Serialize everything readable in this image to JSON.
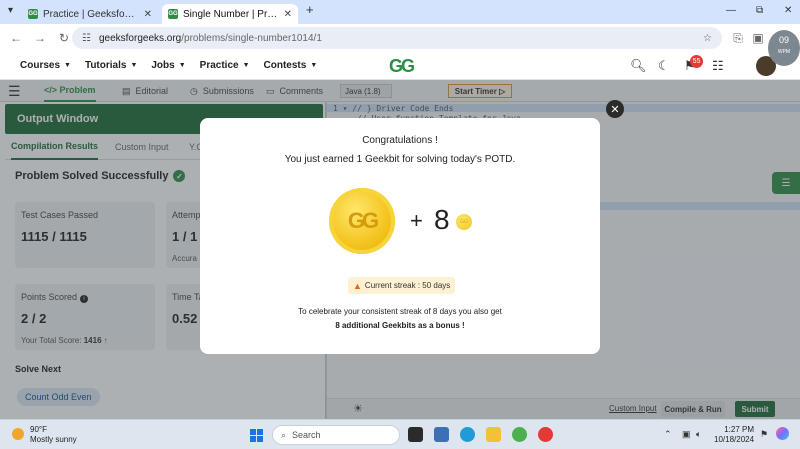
{
  "browser": {
    "tabs": [
      {
        "title": "Practice | GeeksforGeeks | A co"
      },
      {
        "title": "Single Number | Practice | Geek"
      }
    ],
    "url_host": "geeksforgeeks.org",
    "url_path": "/problems/single-number1014/1"
  },
  "site_nav": {
    "menu": [
      "Courses",
      "Tutorials",
      "Jobs",
      "Practice",
      "Contests"
    ],
    "logo_text": "GG",
    "notification_count": "55",
    "wpm_value": "09",
    "wpm_label": "WPM"
  },
  "problem_tabs": [
    "Problem",
    "Editorial",
    "Submissions",
    "Comments"
  ],
  "editor": {
    "language": "Java (1.8)",
    "timer_label": "Start Timer",
    "line_number": "1",
    "code_line1": "// } Driver Code Ends",
    "code_line2": "// User function Template for Java",
    "custom_input": "Custom Input",
    "compile_label": "Compile & Run",
    "submit_label": "Submit"
  },
  "output": {
    "header": "Output Window",
    "tabs": [
      "Compilation Results",
      "Custom Input",
      "Y.O"
    ],
    "status": "Problem Solved Successfully",
    "cards": {
      "test_cases_label": "Test Cases Passed",
      "test_cases_value": "1115 / 1115",
      "attempts_label": "Attemp",
      "attempts_value": "1 / 1",
      "accuracy_label": "Accura",
      "points_label": "Points Scored",
      "points_value": "2 / 2",
      "total_score_label": "Your Total Score:",
      "total_score_value": "1416",
      "time_label": "Time Ta",
      "time_value": "0.52"
    },
    "solve_next": "Solve Next",
    "next_problem": "Count Odd Even"
  },
  "modal": {
    "title": "Congratulations !",
    "subtitle": "You just earned 1 Geekbit for solving today's POTD.",
    "plus": "+",
    "bonus_amount": "8",
    "streak": "Current streak : 50 days",
    "message_line1": "To celebrate your consistent streak of 8 days you also get",
    "message_line2": "8 additional Geekbits as a bonus !"
  },
  "taskbar": {
    "temperature": "90°F",
    "condition": "Mostly sunny",
    "search_placeholder": "Search",
    "time": "1:27 PM",
    "date": "10/18/2024"
  }
}
